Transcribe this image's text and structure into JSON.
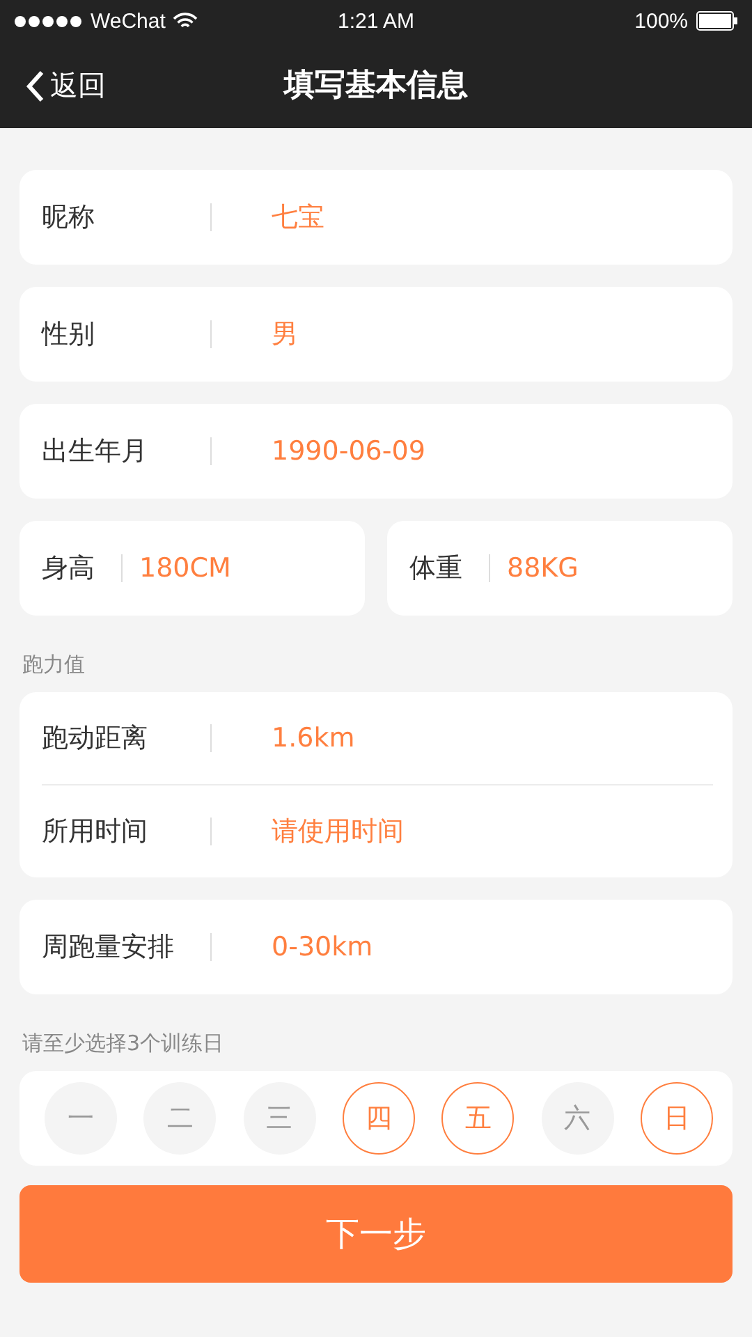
{
  "status_bar": {
    "carrier": "WeChat",
    "time": "1:21 AM",
    "battery": "100%"
  },
  "nav": {
    "back": "返回",
    "title": "填写基本信息"
  },
  "blocks": [
    {
      "kind": "card",
      "fields": [
        {
          "label": "昵称",
          "value": "七宝"
        }
      ]
    },
    {
      "kind": "card",
      "fields": [
        {
          "label": "性别",
          "value": "男"
        }
      ]
    },
    {
      "kind": "card",
      "fields": [
        {
          "label": "出生年月",
          "value": "1990-06-09"
        }
      ]
    },
    {
      "kind": "pair",
      "fields": [
        {
          "label": "身高",
          "value": "180CM"
        },
        {
          "label": "体重",
          "value": "88KG"
        }
      ]
    },
    {
      "kind": "heading",
      "text": "跑力值"
    },
    {
      "kind": "card",
      "fields": [
        {
          "label": "跑动距离",
          "value": "1.6km"
        },
        {
          "label": "所用时间",
          "value": "请使用时间"
        }
      ]
    },
    {
      "kind": "card",
      "fields": [
        {
          "label": "周跑量安排",
          "value": "0-30km"
        }
      ]
    },
    {
      "kind": "heading",
      "text": "请至少选择3个训练日"
    },
    {
      "kind": "days",
      "days": [
        {
          "label": "一",
          "selected": false
        },
        {
          "label": "二",
          "selected": false
        },
        {
          "label": "三",
          "selected": false
        },
        {
          "label": "四",
          "selected": true
        },
        {
          "label": "五",
          "selected": true
        },
        {
          "label": "六",
          "selected": false
        },
        {
          "label": "日",
          "selected": true
        }
      ]
    }
  ],
  "next_button": "下一步"
}
